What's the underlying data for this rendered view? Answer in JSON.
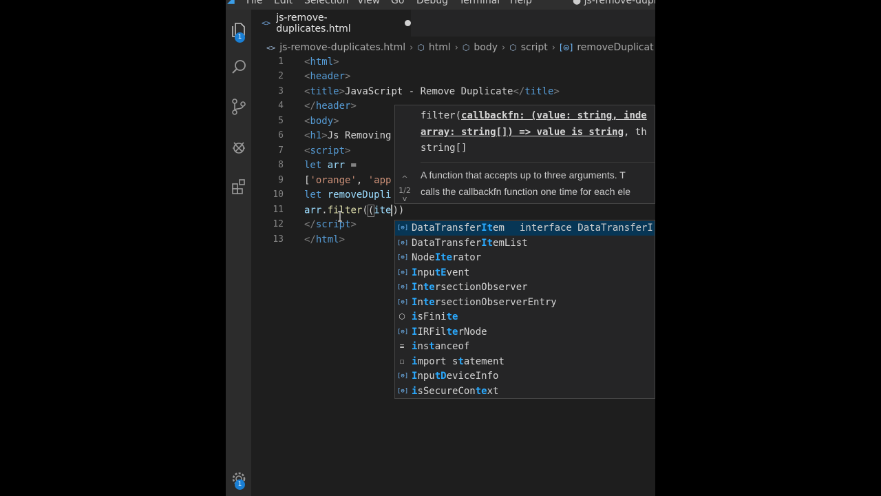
{
  "menubar": {
    "items": [
      "File",
      "Edit",
      "Selection",
      "View",
      "Go",
      "Debug",
      "Terminal",
      "Help"
    ],
    "window_title": "● js-remove-duplicates"
  },
  "activity": {
    "explorer_badge": "1",
    "settings_badge": "1"
  },
  "tab": {
    "icon": "<>",
    "label": "js-remove-duplicates.html"
  },
  "breadcrumb": {
    "file": "js-remove-duplicates.html",
    "items": [
      "html",
      "body",
      "script",
      "removeDuplicat"
    ]
  },
  "editor": {
    "line_numbers": [
      "1",
      "2",
      "3",
      "4",
      "5",
      "6",
      "7",
      "8",
      "9",
      "10",
      "11",
      "12",
      "13"
    ],
    "lines": {
      "l1_tag": "html",
      "l2_tag": "header",
      "l3_open": "title",
      "l3_text": "JavaScript - Remove Duplicate",
      "l3_close": "title",
      "l4_tag": "header",
      "l5_tag": "body",
      "l6_tag": "h1",
      "l6_text": "Js Removing",
      "l7_tag": "script",
      "l8_kw": "let",
      "l8_var": "arr",
      "l8_rest": " =",
      "l9_open": "[",
      "l9_str1": "'orange'",
      "l9_sep": ", ",
      "l9_str2": "'app",
      "l10_kw": "let",
      "l10_var": "removeDupli",
      "l11_obj": "arr",
      "l11_dot": ".",
      "l11_fn": "filter",
      "l11_paren": "(",
      "l11_open2": "(",
      "l11_param": "ite",
      "l11_close": "))",
      "l12_tag": "script",
      "l13_tag": "html"
    }
  },
  "param_hint": {
    "sig_line1_pre": "filter(",
    "sig_line1_param": "callbackfn: (value: string, inde",
    "sig_line2_param": "array: string[]) => value is string",
    "sig_line2_post": ", th",
    "sig_line3": "string[]",
    "doc_line1": "A function that accepts up to three arguments. T",
    "doc_line2": "calls the callbackfn function one time for each ele",
    "nav_counter": "1/2",
    "nav_up": "^",
    "nav_down": "v"
  },
  "suggestions": [
    {
      "icon": "interface-icon",
      "pre": "DataTransfer",
      "hl1": "It",
      "mid": "",
      "hl2": "",
      "post": "em",
      "detail": "interface DataTransferI",
      "selected": true
    },
    {
      "icon": "interface-icon",
      "pre": "DataTransfer",
      "hl1": "It",
      "mid": "",
      "hl2": "",
      "post": "emList",
      "detail": ""
    },
    {
      "icon": "interface-icon",
      "pre": "Node",
      "hl1": "It",
      "mid": "",
      "hl2": "e",
      "post": "rator",
      "detail": ""
    },
    {
      "icon": "interface-icon",
      "pre": "",
      "hl1": "I",
      "mid": "npu",
      "hl2": "tE",
      "post": "vent",
      "detail": ""
    },
    {
      "icon": "interface-icon",
      "pre": "",
      "hl1": "I",
      "mid": "n",
      "hl2": "te",
      "post": "rsectionObserver",
      "detail": ""
    },
    {
      "icon": "interface-icon",
      "pre": "",
      "hl1": "I",
      "mid": "n",
      "hl2": "te",
      "post": "rsectionObserverEntry",
      "detail": ""
    },
    {
      "icon": "method-cube-icon",
      "pre": "",
      "hl1": "i",
      "mid": "sFini",
      "hl2": "te",
      "post": "",
      "detail": ""
    },
    {
      "icon": "interface-icon",
      "pre": "",
      "hl1": "I",
      "mid": "IRFil",
      "hl2": "te",
      "post": "rNode",
      "detail": ""
    },
    {
      "icon": "keyword-icon",
      "pre": "",
      "hl1": "i",
      "mid": "ns",
      "hl2": "t",
      "post": "anceof",
      "detail": ""
    },
    {
      "icon": "snippet-icon",
      "pre": "",
      "hl1": "i",
      "mid": "mport s",
      "hl2": "t",
      "post": "atement",
      "detail": ""
    },
    {
      "icon": "interface-icon",
      "pre": "",
      "hl1": "I",
      "mid": "npu",
      "hl2": "tD",
      "post": "eviceInfo",
      "detail": ""
    },
    {
      "icon": "interface-icon",
      "pre": "",
      "hl1": "i",
      "mid": "sSecureCon",
      "hl2": "te",
      "post": "xt",
      "detail": ""
    }
  ],
  "colors": {
    "accent": "#1a7fd4",
    "editor_bg": "#1e1e1e",
    "highlight": "#2aaaff",
    "selected_row": "#073655"
  }
}
